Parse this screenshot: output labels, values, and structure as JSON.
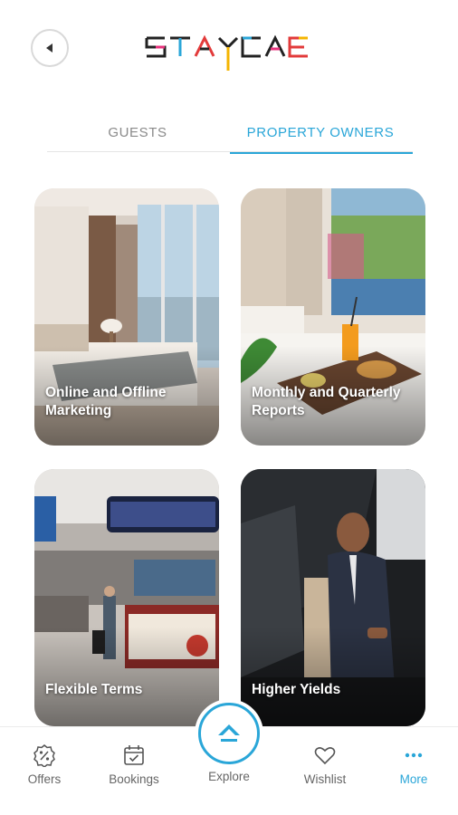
{
  "header": {
    "back_icon": "back-arrow-icon",
    "logo_text": "STAYCAE"
  },
  "tabs": [
    {
      "label": "GUESTS",
      "active": false
    },
    {
      "label": "PROPERTY OWNERS",
      "active": true
    }
  ],
  "cards": [
    {
      "title": "Online and Offline Marketing",
      "image": "hotel-bedroom"
    },
    {
      "title": "Monthly and Quarterly Reports",
      "image": "breakfast-tray"
    },
    {
      "title": "Flexible Terms",
      "image": "airport-terminal"
    },
    {
      "title": "Higher Yields",
      "image": "man-exiting-car"
    }
  ],
  "bottom_nav": {
    "offers": {
      "label": "Offers",
      "icon": "percent-badge-icon"
    },
    "bookings": {
      "label": "Bookings",
      "icon": "calendar-check-icon"
    },
    "explore": {
      "label": "Explore",
      "icon": "explore-home-icon"
    },
    "wishlist": {
      "label": "Wishlist",
      "icon": "heart-icon"
    },
    "more": {
      "label": "More",
      "icon": "more-dots-icon",
      "active": true
    }
  },
  "colors": {
    "accent": "#2aa6d8",
    "inactive_text": "#8a8a8a",
    "logo_pink": "#e8327c",
    "logo_red": "#e23a3a",
    "logo_teal": "#2aa6d8",
    "logo_yellow": "#f4b400"
  }
}
